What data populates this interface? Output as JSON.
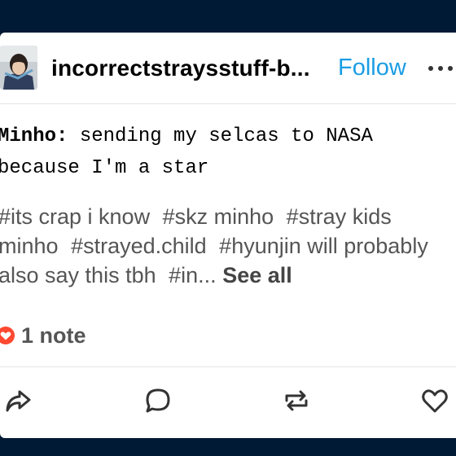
{
  "post": {
    "blog_name": "incorrectstraysstuff-b...",
    "follow_label": "Follow",
    "speaker": "Minho:",
    "line1": " sending my selcas to NASA",
    "line2": "because I'm a star",
    "tags": [
      "#its crap i know",
      "#skz minho",
      "#stray kids minho",
      "#strayed.child",
      "#hyunjin will probably also say this tbh",
      "#in..."
    ],
    "see_all_label": "See all",
    "notes_label": "1 note"
  },
  "colors": {
    "background": "#001935",
    "follow_blue": "#1a9de4",
    "heart_red": "#ff4930",
    "icon_gray": "#333333"
  },
  "icons": [
    "more-icon",
    "heart-badge-icon",
    "share-icon",
    "reply-icon",
    "reblog-icon",
    "like-icon"
  ]
}
